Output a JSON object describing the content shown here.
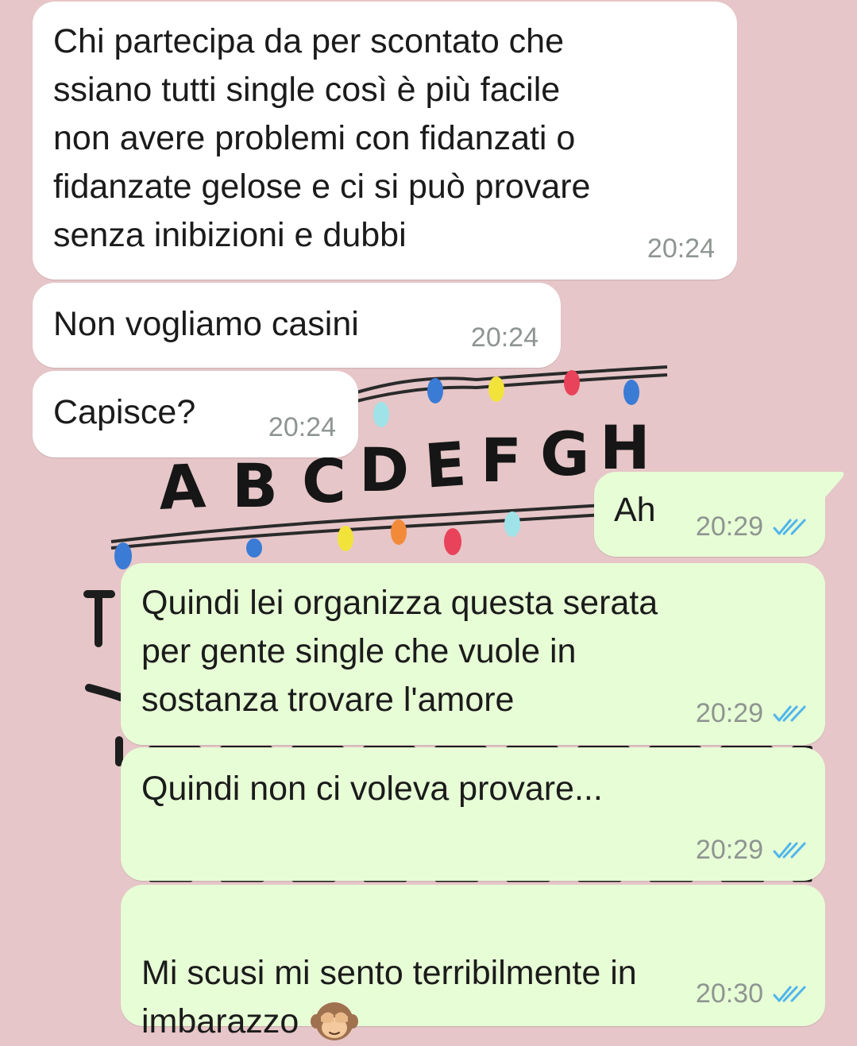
{
  "wallpaper": {
    "letters_row1": [
      "A",
      "B",
      "C",
      "D",
      "E",
      "F",
      "G",
      "H"
    ]
  },
  "messages": [
    {
      "direction": "incoming",
      "text": "Chi partecipa da per scontato che\nssiano tutti single così è più facile\nnon avere problemi con fidanzati o\nfidanzate gelose e ci si può provare\nsenza inibizioni e dubbi",
      "time": "20:24"
    },
    {
      "direction": "incoming",
      "text": "Non vogliamo casini",
      "time": "20:24"
    },
    {
      "direction": "incoming",
      "text": "Capisce?",
      "time": "20:24"
    },
    {
      "direction": "outgoing",
      "text": "Ah",
      "time": "20:29",
      "status": "read"
    },
    {
      "direction": "outgoing",
      "text": "Quindi lei organizza questa serata\nper gente single che vuole in\nsostanza trovare l'amore",
      "time": "20:29",
      "status": "read"
    },
    {
      "direction": "outgoing",
      "text": "Quindi non ci voleva provare...",
      "time": "20:29",
      "status": "read"
    },
    {
      "direction": "outgoing",
      "text": "Mi scusi mi sento terribilmente in\nimbarazzo",
      "emoji": "see-no-evil-monkey-icon",
      "time": "20:30",
      "status": "read"
    }
  ],
  "colors": {
    "background": "#e6c6c8",
    "incoming_bubble": "#ffffff",
    "outgoing_bubble": "#e7fdd6",
    "read_ticks": "#4fb6ec",
    "timestamp": "#8e9591"
  }
}
